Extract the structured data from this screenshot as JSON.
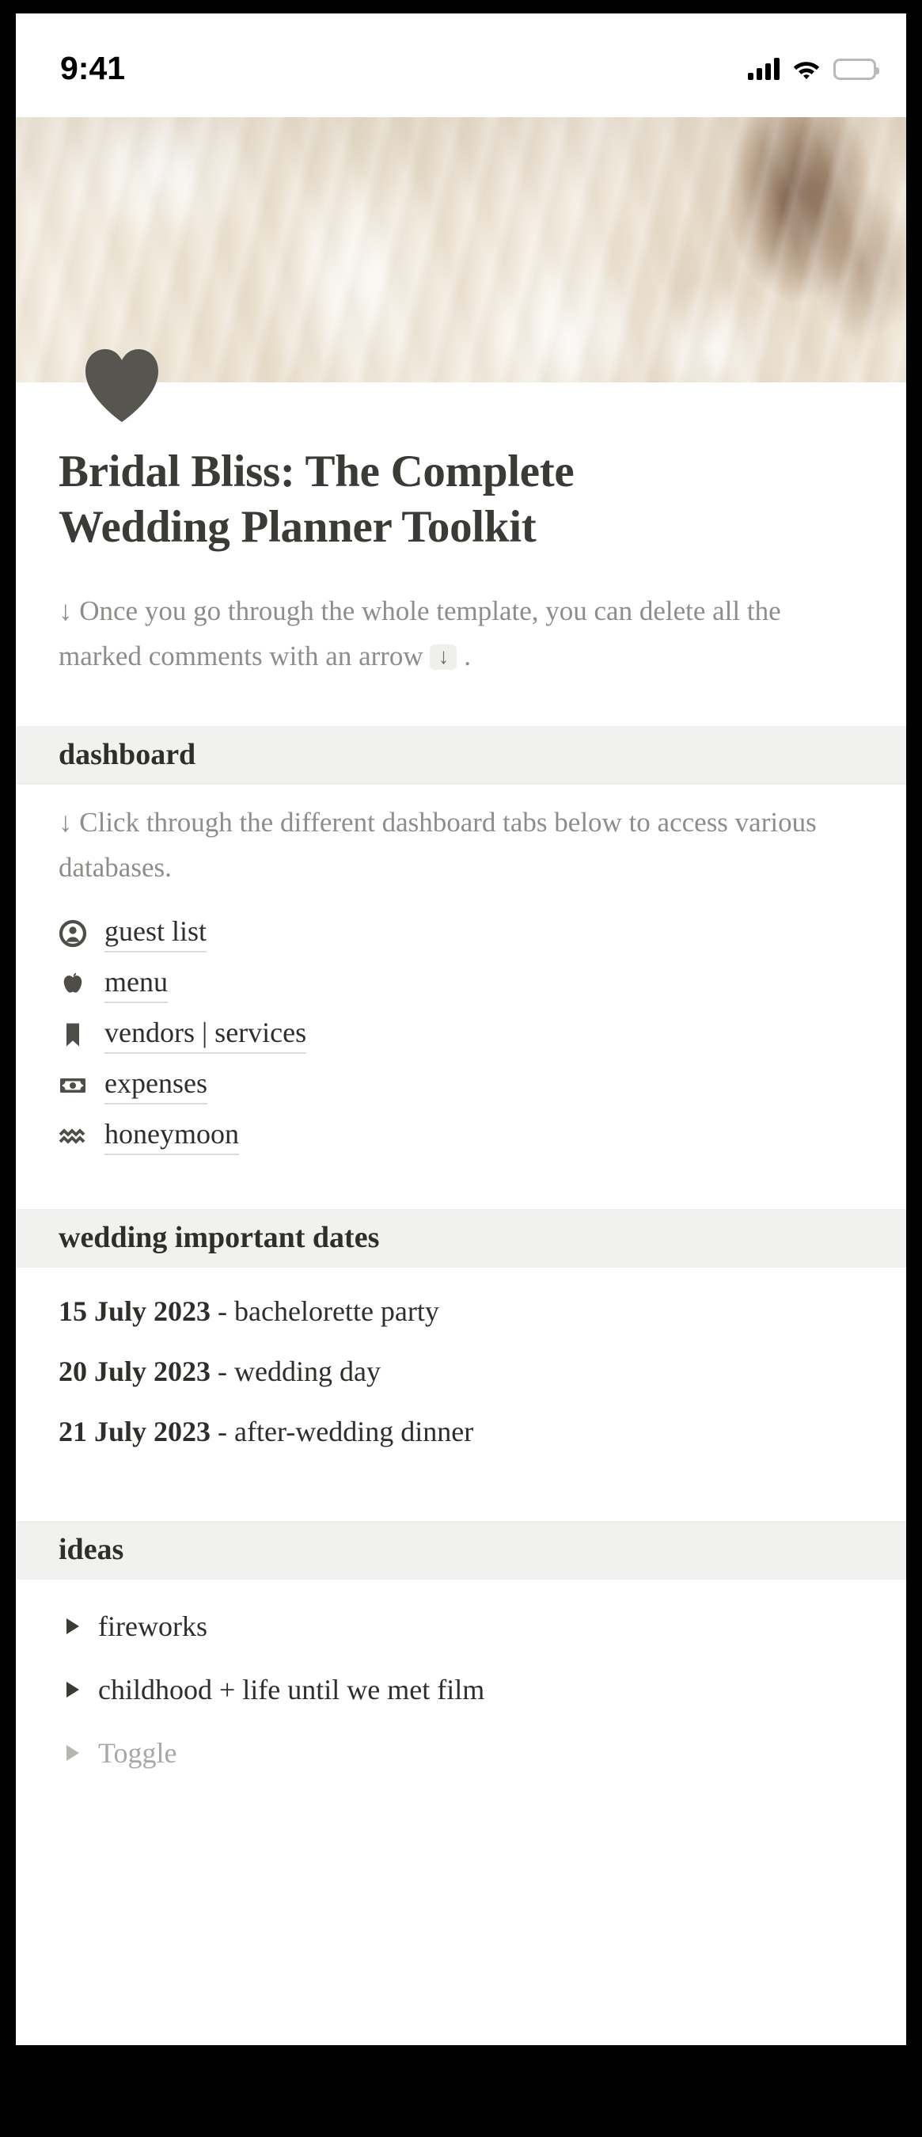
{
  "status_bar": {
    "time": "9:41",
    "signal_icon": "signal-bars-icon",
    "wifi_icon": "wifi-icon",
    "battery_icon": "battery-full-icon"
  },
  "cover": {
    "alt": "white peony petals close-up",
    "page_icon": "heart-icon",
    "icon_color": "#57554f"
  },
  "page": {
    "title": "Bridal Bliss: The Complete Wedding Planner Toolkit",
    "intro_comment_before": "↓ Once you go through the whole template, you can delete all the marked comments with an arrow ",
    "intro_chip": "↓",
    "intro_comment_after": " ."
  },
  "dashboard": {
    "heading": "dashboard",
    "comment": "↓ Click through the different dashboard tabs below to access various databases.",
    "items": [
      {
        "label": "guest list",
        "icon": "person-circle-icon"
      },
      {
        "label": "menu",
        "icon": "apple-icon"
      },
      {
        "label": "vendors | services",
        "icon": "bookmark-icon"
      },
      {
        "label": "expenses",
        "icon": "banknote-icon"
      },
      {
        "label": "honeymoon",
        "icon": "waves-icon"
      }
    ]
  },
  "important_dates": {
    "heading": "wedding important dates",
    "rows": [
      {
        "date": "15 July 2023",
        "separator": " - ",
        "event": "bachelorette party"
      },
      {
        "date": "20 July 2023",
        "separator": " - ",
        "event": "wedding day"
      },
      {
        "date": "21 July 2023",
        "separator": " - ",
        "event": "after-wedding dinner"
      }
    ]
  },
  "ideas": {
    "heading": "ideas",
    "toggles": [
      {
        "label": "fireworks",
        "muted": false
      },
      {
        "label": "childhood + life until we met film",
        "muted": false
      },
      {
        "label": "Toggle",
        "muted": true
      }
    ]
  },
  "colors": {
    "text_primary": "#2f2e2b",
    "text_muted": "#8d8d8a",
    "section_band": "#f1f1ef",
    "underline": "#dcdbd7",
    "icon": "#57554f"
  }
}
